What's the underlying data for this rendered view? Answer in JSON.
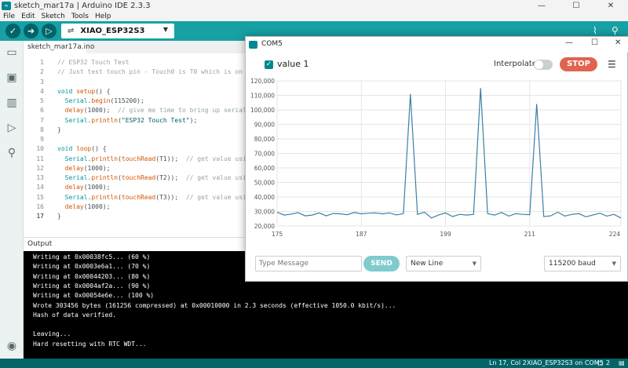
{
  "window": {
    "title": "sketch_mar17a | Arduino IDE 2.3.3",
    "controls": [
      "—",
      "☐",
      "✕"
    ]
  },
  "menu": [
    "File",
    "Edit",
    "Sketch",
    "Tools",
    "Help"
  ],
  "toolbar": {
    "board": "XIAO_ESP32S3"
  },
  "editor": {
    "tab": "sketch_mar17a.ino",
    "line_numbers": [
      "1",
      "2",
      "3",
      "4",
      "5",
      "6",
      "7",
      "8",
      "9",
      "10",
      "11",
      "12",
      "13",
      "14",
      "15",
      "16",
      "17"
    ],
    "code": [
      [
        {
          "t": "// ESP32 Touch Test",
          "c": "cmt"
        }
      ],
      [
        {
          "t": "// Just test touch pin - Touch0 is T0 which is on",
          "c": "cmt"
        }
      ],
      [],
      [
        {
          "t": "void ",
          "c": "kw"
        },
        {
          "t": "setup",
          "c": "fn"
        },
        {
          "t": "() {",
          "c": ""
        }
      ],
      [
        {
          "t": "  ",
          "c": ""
        },
        {
          "t": "Serial",
          "c": "kw"
        },
        {
          "t": ".",
          "c": ""
        },
        {
          "t": "begin",
          "c": "fn"
        },
        {
          "t": "(115200);",
          "c": ""
        }
      ],
      [
        {
          "t": "  ",
          "c": ""
        },
        {
          "t": "delay",
          "c": "fn"
        },
        {
          "t": "(1000);  ",
          "c": ""
        },
        {
          "t": "// give me time to bring up serial",
          "c": "cmt"
        }
      ],
      [
        {
          "t": "  ",
          "c": ""
        },
        {
          "t": "Serial",
          "c": "kw"
        },
        {
          "t": ".",
          "c": ""
        },
        {
          "t": "println",
          "c": "fn"
        },
        {
          "t": "(",
          "c": ""
        },
        {
          "t": "\"ESP32 Touch Test\"",
          "c": "str"
        },
        {
          "t": ");",
          "c": ""
        }
      ],
      [
        {
          "t": "}",
          "c": ""
        }
      ],
      [],
      [
        {
          "t": "void ",
          "c": "kw"
        },
        {
          "t": "loop",
          "c": "fn"
        },
        {
          "t": "() {",
          "c": ""
        }
      ],
      [
        {
          "t": "  ",
          "c": ""
        },
        {
          "t": "Serial",
          "c": "kw"
        },
        {
          "t": ".",
          "c": ""
        },
        {
          "t": "println",
          "c": "fn"
        },
        {
          "t": "(",
          "c": ""
        },
        {
          "t": "touchRead",
          "c": "fn"
        },
        {
          "t": "(T1));  ",
          "c": ""
        },
        {
          "t": "// get value usi",
          "c": "cmt"
        }
      ],
      [
        {
          "t": "  ",
          "c": ""
        },
        {
          "t": "delay",
          "c": "fn"
        },
        {
          "t": "(1000);",
          "c": ""
        }
      ],
      [
        {
          "t": "  ",
          "c": ""
        },
        {
          "t": "Serial",
          "c": "kw"
        },
        {
          "t": ".",
          "c": ""
        },
        {
          "t": "println",
          "c": "fn"
        },
        {
          "t": "(",
          "c": ""
        },
        {
          "t": "touchRead",
          "c": "fn"
        },
        {
          "t": "(T2));  ",
          "c": ""
        },
        {
          "t": "// get value usi",
          "c": "cmt"
        }
      ],
      [
        {
          "t": "  ",
          "c": ""
        },
        {
          "t": "delay",
          "c": "fn"
        },
        {
          "t": "(1000);",
          "c": ""
        }
      ],
      [
        {
          "t": "  ",
          "c": ""
        },
        {
          "t": "Serial",
          "c": "kw"
        },
        {
          "t": ".",
          "c": ""
        },
        {
          "t": "println",
          "c": "fn"
        },
        {
          "t": "(",
          "c": ""
        },
        {
          "t": "touchRead",
          "c": "fn"
        },
        {
          "t": "(T3));  ",
          "c": ""
        },
        {
          "t": "// get value usi",
          "c": "cmt"
        }
      ],
      [
        {
          "t": "  ",
          "c": ""
        },
        {
          "t": "delay",
          "c": "fn"
        },
        {
          "t": "(1000);",
          "c": ""
        }
      ],
      [
        {
          "t": "}",
          "c": ""
        }
      ]
    ]
  },
  "output": {
    "title": "Output",
    "lines": [
      "Writing at 0x00038fc5... (60 %)",
      "Writing at 0x0003e6a1... (70 %)",
      "Writing at 0x00044203... (80 %)",
      "Writing at 0x0004af2a... (90 %)",
      "Writing at 0x00054e6e... (100 %)",
      "Wrote 303456 bytes (161256 compressed) at 0x00010000 in 2.3 seconds (effective 1050.0 kbit/s)...",
      "Hash of data verified.",
      "",
      "Leaving...",
      "Hard resetting with RTC WDT..."
    ]
  },
  "status": {
    "position": "Ln 17, Col 2",
    "board_port": "XIAO_ESP32S3 on COM5",
    "notifications": "2"
  },
  "plotter": {
    "title": "COM5",
    "series_label": "value 1",
    "interpolate_label": "Interpolate",
    "interpolate_on": false,
    "stop_label": "STOP",
    "message_placeholder": "Type Message",
    "send_label": "SEND",
    "line_ending": "New Line",
    "baud": "115200 baud",
    "accent": "#00878f",
    "stop_color": "#e0644e"
  },
  "chart_data": {
    "type": "line",
    "title": "",
    "xlabel": "",
    "ylabel": "",
    "xlim": [
      175,
      224
    ],
    "ylim": [
      20000,
      120000
    ],
    "xticks": [
      "175",
      "187",
      "199",
      "211",
      "224"
    ],
    "xtick_values": [
      175,
      187,
      199,
      211,
      224
    ],
    "yticks": [
      "20,000",
      "30,000",
      "40,000",
      "50,000",
      "60,000",
      "70,000",
      "80,000",
      "90,000",
      "100,000",
      "110,000",
      "120,000"
    ],
    "ytick_values": [
      20000,
      30000,
      40000,
      50000,
      60000,
      70000,
      80000,
      90000,
      100000,
      110000,
      120000
    ],
    "grid": true,
    "line_color": "#3a80a6",
    "series": [
      {
        "name": "value 1",
        "x": [
          175,
          176,
          177,
          178,
          179,
          180,
          181,
          182,
          183,
          184,
          185,
          186,
          187,
          188,
          189,
          190,
          191,
          192,
          193,
          194,
          195,
          196,
          197,
          198,
          199,
          200,
          201,
          202,
          203,
          204,
          205,
          206,
          207,
          208,
          209,
          210,
          211,
          212,
          213,
          214,
          215,
          216,
          217,
          218,
          219,
          220,
          221,
          222,
          223,
          224
        ],
        "y": [
          29500,
          27500,
          28200,
          29200,
          27000,
          27500,
          29000,
          27000,
          28600,
          28400,
          27800,
          29300,
          28400,
          28800,
          29000,
          28400,
          29000,
          27600,
          28500,
          111000,
          28000,
          29500,
          25500,
          27500,
          29000,
          26500,
          28000,
          27500,
          28000,
          115000,
          28500,
          27500,
          29300,
          26800,
          28500,
          28000,
          27800,
          104000,
          26500,
          27000,
          29500,
          26800,
          28000,
          28500,
          26300,
          27500,
          28800,
          26800,
          28000,
          25500
        ]
      }
    ]
  }
}
